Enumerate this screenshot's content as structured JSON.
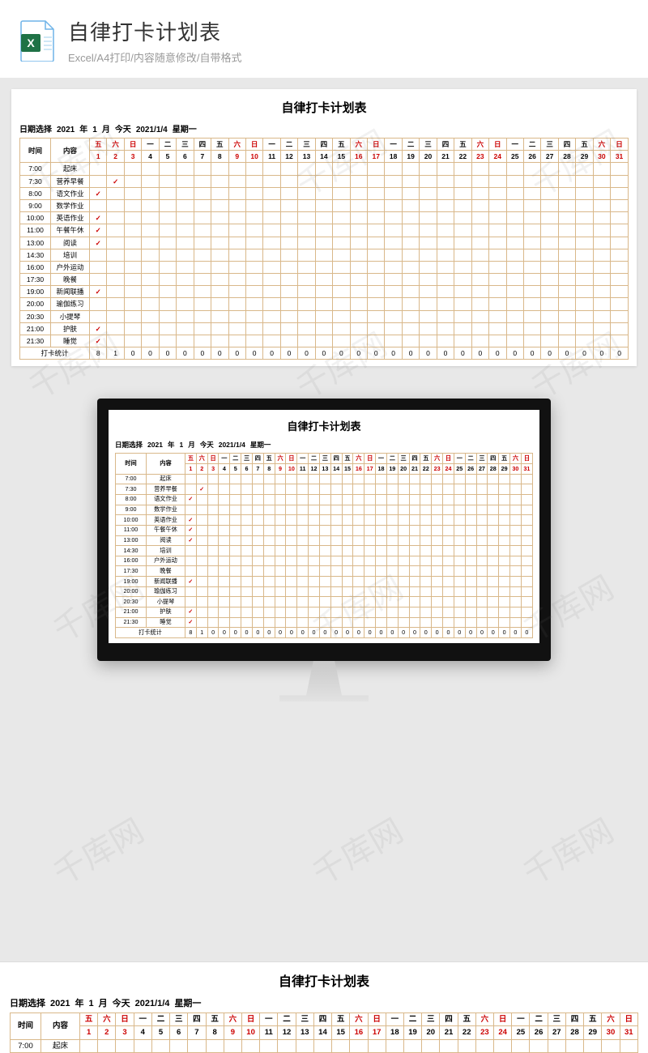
{
  "header": {
    "title": "自律打卡计划表",
    "subtitle": "Excel/A4打印/内容随意修改/自带格式"
  },
  "sheet": {
    "title": "自律打卡计划表",
    "date_label": "日期选择",
    "year": "2021",
    "year_unit": "年",
    "month": "1",
    "month_unit": "月",
    "today_label": "今天",
    "today_date": "2021/1/4",
    "weekday": "星期一",
    "col_time": "时间",
    "col_content": "内容",
    "weekdays": [
      "五",
      "六",
      "日",
      "一",
      "二",
      "三",
      "四",
      "五",
      "六",
      "日",
      "一",
      "二",
      "三",
      "四",
      "五",
      "六",
      "日",
      "一",
      "二",
      "三",
      "四",
      "五",
      "六",
      "日",
      "一",
      "二",
      "三",
      "四",
      "五",
      "六",
      "日"
    ],
    "weekday_red": [
      0,
      1,
      2,
      8,
      9,
      15,
      16,
      22,
      23,
      29,
      30
    ],
    "days": [
      "1",
      "2",
      "3",
      "4",
      "5",
      "6",
      "7",
      "8",
      "9",
      "10",
      "11",
      "12",
      "13",
      "14",
      "15",
      "16",
      "17",
      "18",
      "19",
      "20",
      "21",
      "22",
      "23",
      "24",
      "25",
      "26",
      "27",
      "28",
      "29",
      "30",
      "31"
    ],
    "day_red": [
      0,
      1,
      2,
      8,
      9,
      15,
      16,
      22,
      23,
      29,
      30
    ],
    "rows": [
      {
        "time": "7:00",
        "content": "起床",
        "checks": []
      },
      {
        "time": "7:30",
        "content": "营养早餐",
        "checks": [
          1
        ]
      },
      {
        "time": "8:00",
        "content": "语文作业",
        "checks": [
          0
        ]
      },
      {
        "time": "9:00",
        "content": "数学作业",
        "checks": []
      },
      {
        "time": "10:00",
        "content": "英语作业",
        "checks": [
          0
        ]
      },
      {
        "time": "11:00",
        "content": "午餐午休",
        "checks": [
          0
        ]
      },
      {
        "time": "13:00",
        "content": "阅读",
        "checks": [
          0
        ]
      },
      {
        "time": "14:30",
        "content": "培训",
        "checks": []
      },
      {
        "time": "16:00",
        "content": "户外运动",
        "checks": []
      },
      {
        "time": "17:30",
        "content": "晚餐",
        "checks": []
      },
      {
        "time": "19:00",
        "content": "新闻联播",
        "checks": [
          0
        ]
      },
      {
        "time": "20:00",
        "content": "瑜伽练习",
        "checks": []
      },
      {
        "time": "20:30",
        "content": "小提琴",
        "checks": []
      },
      {
        "time": "21:00",
        "content": "护肤",
        "checks": [
          0
        ]
      },
      {
        "time": "21:30",
        "content": "睡觉",
        "checks": [
          0
        ]
      }
    ],
    "stat_label": "打卡统计",
    "stats": [
      "8",
      "1",
      "0",
      "0",
      "0",
      "0",
      "0",
      "0",
      "0",
      "0",
      "0",
      "0",
      "0",
      "0",
      "0",
      "0",
      "0",
      "0",
      "0",
      "0",
      "0",
      "0",
      "0",
      "0",
      "0",
      "0",
      "0",
      "0",
      "0",
      "0",
      "0"
    ]
  },
  "watermark": "千库网",
  "check_mark": "✓"
}
